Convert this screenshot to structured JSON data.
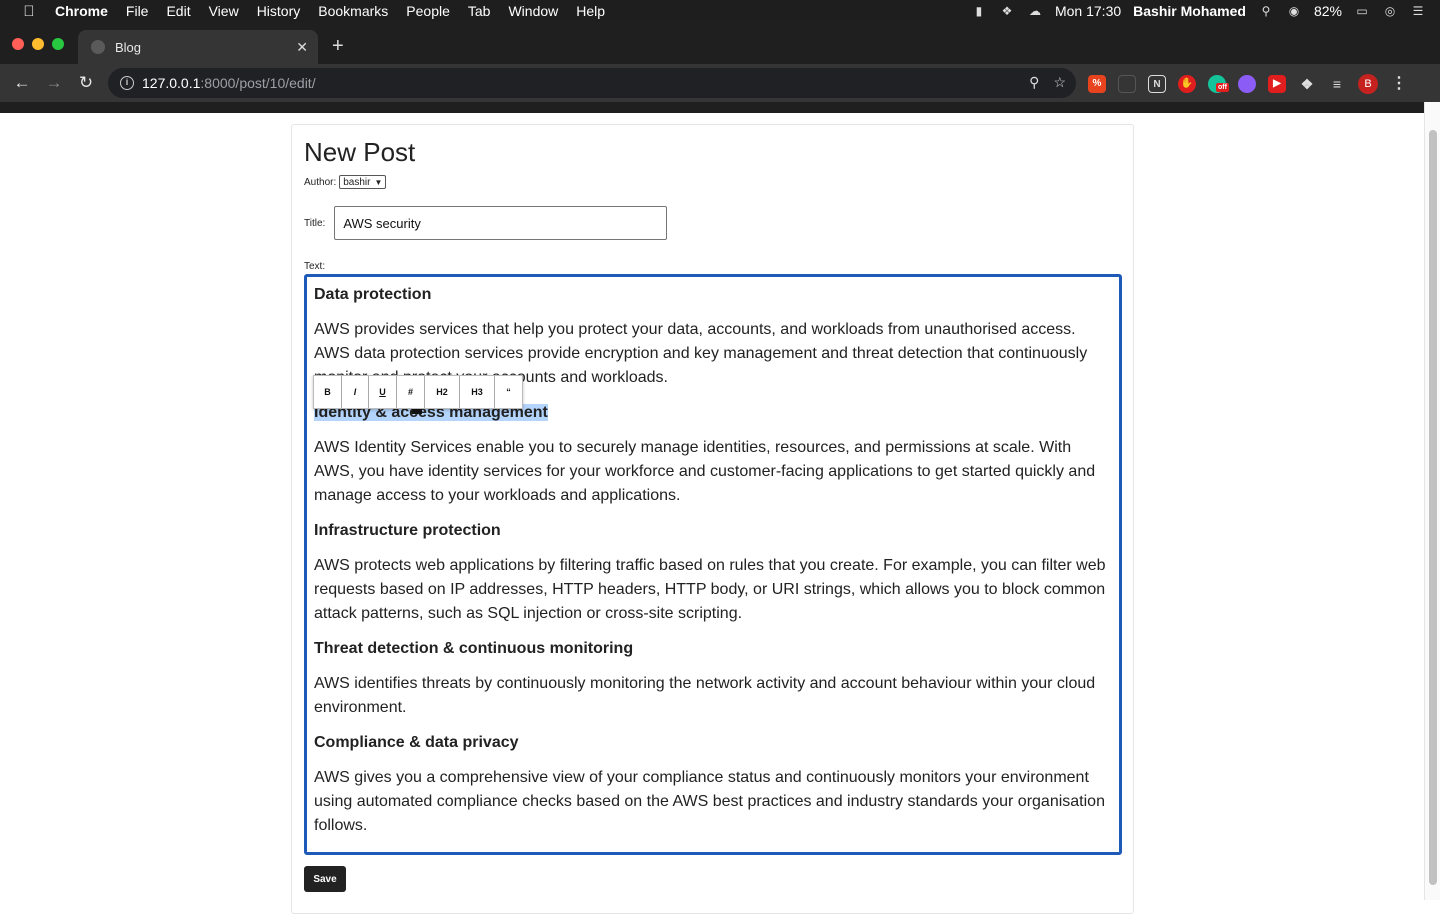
{
  "menubar": {
    "app": "Chrome",
    "items": [
      "File",
      "Edit",
      "View",
      "History",
      "Bookmarks",
      "People",
      "Tab",
      "Window",
      "Help"
    ],
    "clock": "Mon 17:30",
    "user": "Bashir Mohamed",
    "battery": "82%"
  },
  "tab": {
    "title": "Blog"
  },
  "address": {
    "host": "127.0.0.1",
    "path": ":8000/post/10/edit/"
  },
  "toolbar": {
    "profile_initial": "B",
    "ext_badge": "off"
  },
  "form": {
    "page_title": "New Post",
    "author_label": "Author:",
    "author_value": "bashir",
    "title_label": "Title:",
    "title_value": "AWS security",
    "text_label": "Text:",
    "save_label": "Save"
  },
  "format_toolbar": {
    "buttons": [
      "B",
      "I",
      "U",
      "#",
      "H2",
      "H3",
      "“"
    ]
  },
  "content": [
    {
      "type": "h",
      "text": "Data protection"
    },
    {
      "type": "p",
      "text": "AWS provides services that help you protect your data, accounts, and workloads from unauthorised access. AWS data protection services provide encryption and key management and threat detection that continuously monitor and protect your accounts and workloads."
    },
    {
      "type": "h",
      "text": "Identity & access management",
      "selected": true
    },
    {
      "type": "p",
      "text": "AWS Identity Services enable you to securely manage identities, resources, and permissions at scale. With AWS, you have identity services for your workforce and customer-facing applications to get started quickly and manage access to your workloads and applications."
    },
    {
      "type": "h",
      "text": "Infrastructure protection"
    },
    {
      "type": "p",
      "text": "AWS protects web applications by filtering traffic based on rules that you create. For example, you can filter web requests based on IP addresses, HTTP headers, HTTP body, or URI strings, which allows you to block common attack patterns, such as SQL injection or cross-site scripting."
    },
    {
      "type": "h",
      "text": "Threat detection & continuous monitoring"
    },
    {
      "type": "p",
      "text": "AWS identifies threats by continuously monitoring the network activity and account behaviour within your cloud environment."
    },
    {
      "type": "h",
      "text": "Compliance & data privacy"
    },
    {
      "type": "p",
      "text": "AWS gives you a comprehensive view of your compliance status and continuously monitors your environment using automated compliance checks based on the AWS best practices and industry standards your organisation follows."
    }
  ]
}
